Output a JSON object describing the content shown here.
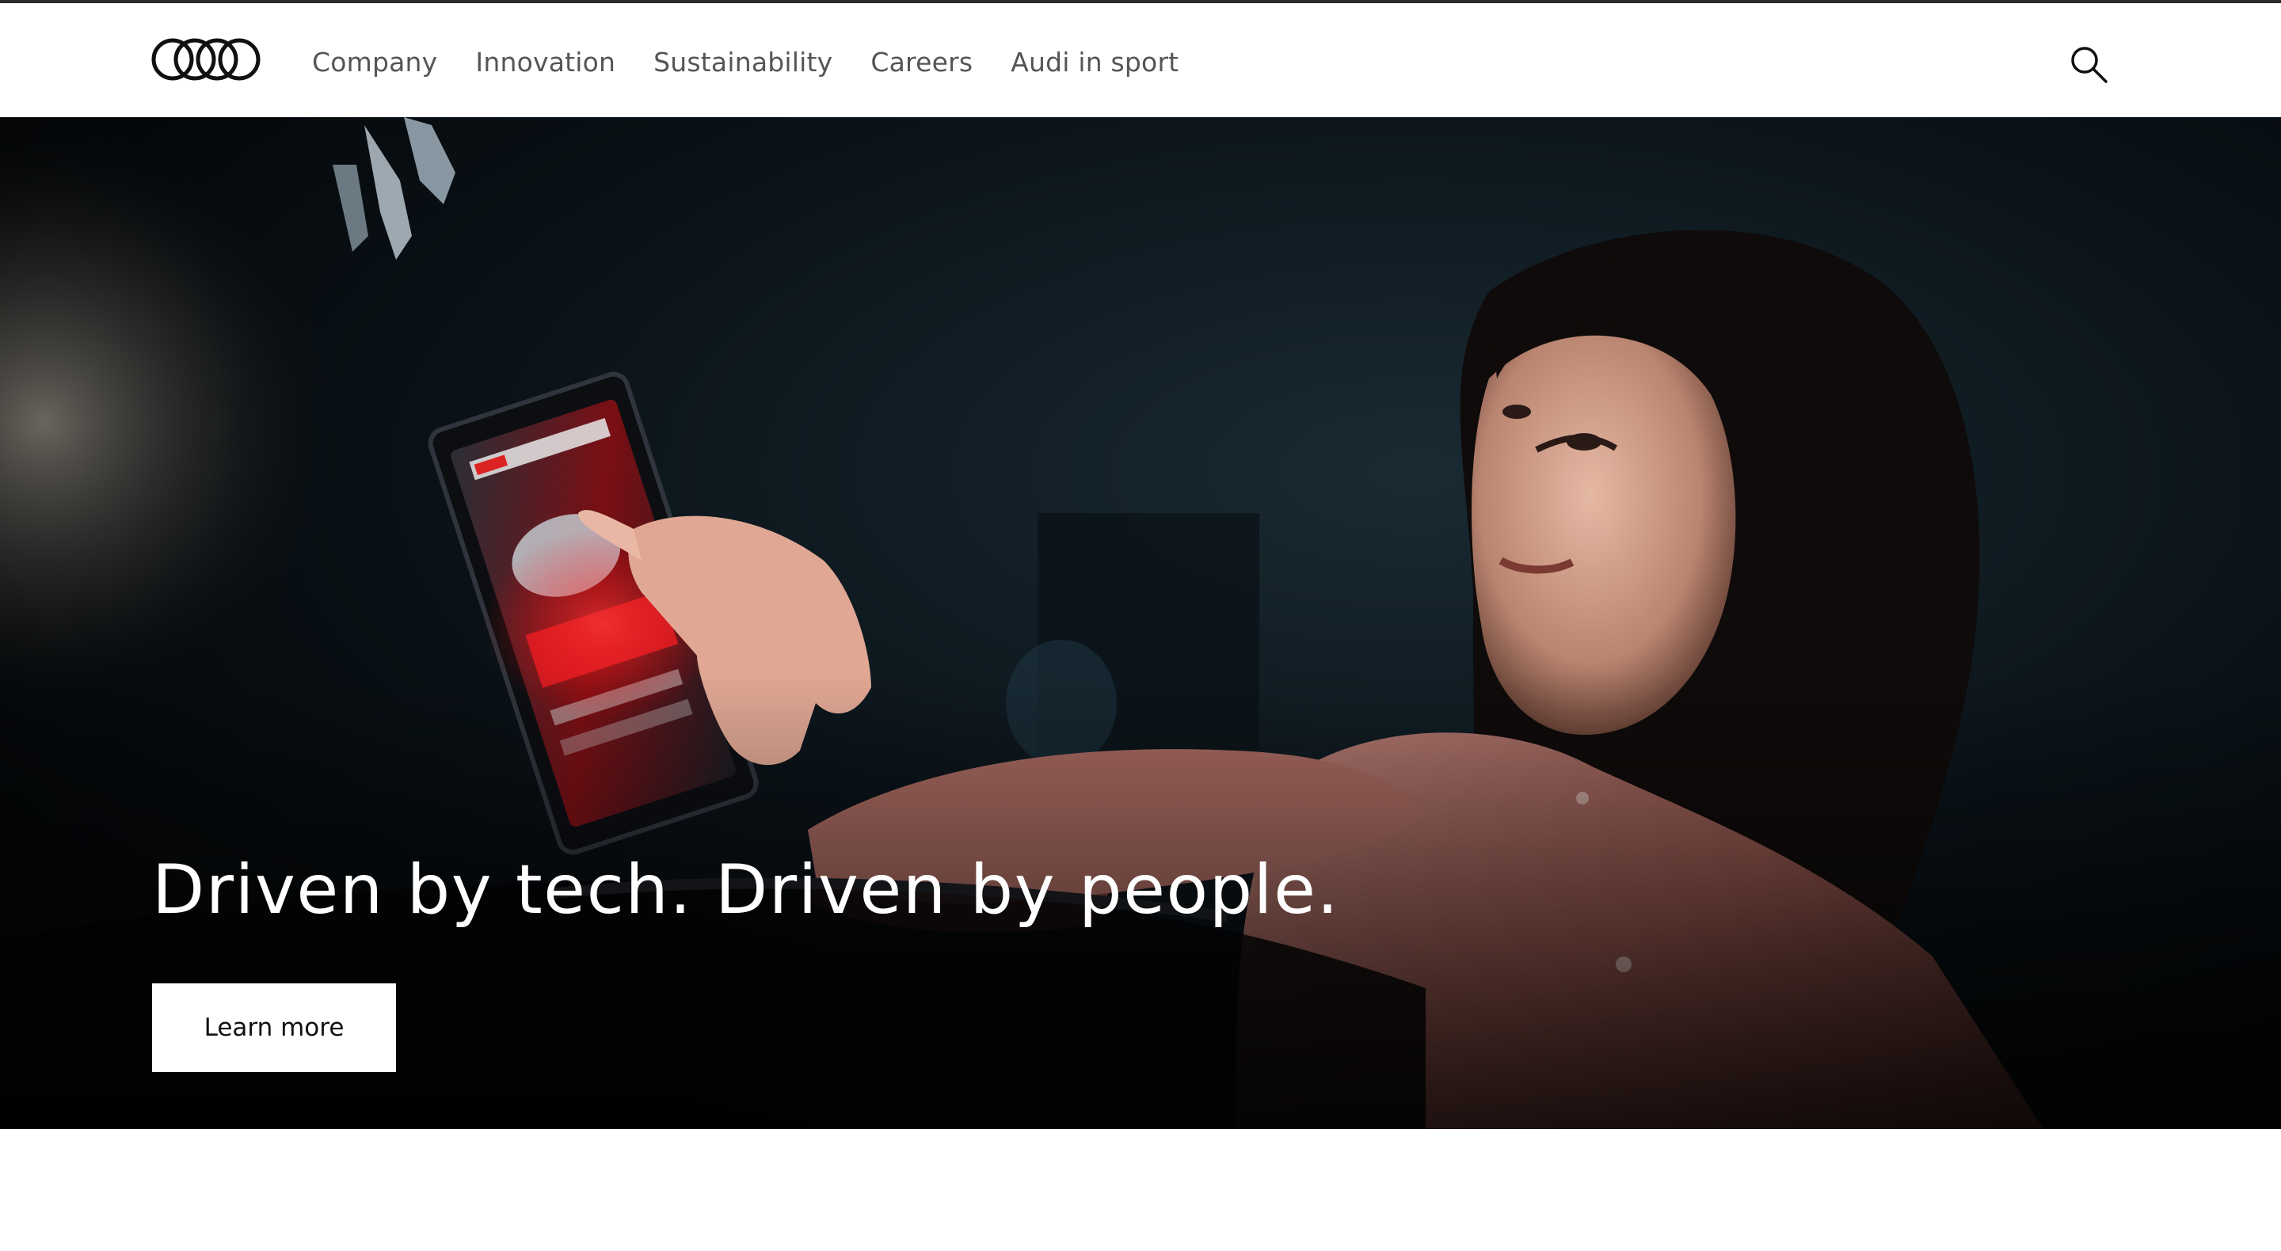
{
  "header": {
    "logo_icon": "audi-rings-logo-icon",
    "nav": [
      {
        "label": "Company"
      },
      {
        "label": "Innovation"
      },
      {
        "label": "Sustainability"
      },
      {
        "label": "Careers"
      },
      {
        "label": "Audi in sport"
      }
    ],
    "search_icon": "search-icon"
  },
  "hero": {
    "headline": "Driven by tech. Driven by people.",
    "cta_label": "Learn more",
    "image": "photo-woman-touching-car-display"
  },
  "colors": {
    "nav_text": "#555555",
    "hero_bg": "#05080c",
    "cta_bg": "#ffffff",
    "headline": "#ffffff"
  }
}
